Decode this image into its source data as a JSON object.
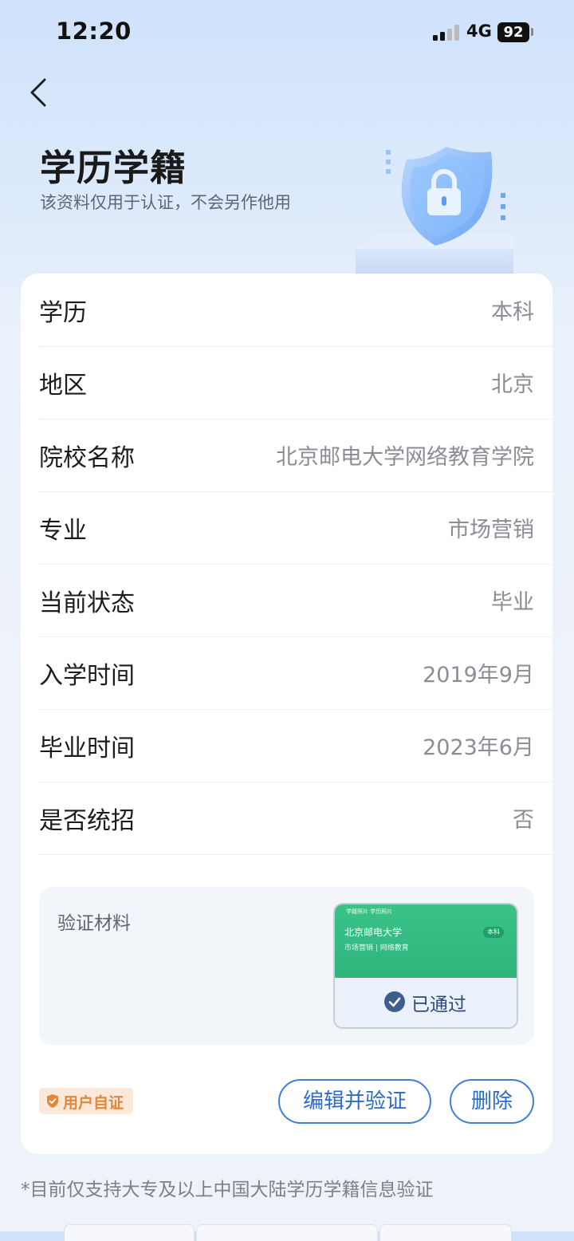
{
  "status_bar": {
    "time": "12:20",
    "network": "4G",
    "battery": "92"
  },
  "header": {
    "title": "学历学籍",
    "subtitle": "该资料仅用于认证，不会另作他用"
  },
  "details": [
    {
      "label": "学历",
      "value": "本科"
    },
    {
      "label": "地区",
      "value": "北京"
    },
    {
      "label": "院校名称",
      "value": "北京邮电大学网络教育学院"
    },
    {
      "label": "专业",
      "value": "市场营销"
    },
    {
      "label": "当前状态",
      "value": "毕业"
    },
    {
      "label": "入学时间",
      "value": "2019年9月"
    },
    {
      "label": "毕业时间",
      "value": "2023年6月"
    },
    {
      "label": "是否统招",
      "value": "否"
    }
  ],
  "material": {
    "label": "验证材料",
    "thumbnail": {
      "tabs": "学籍照片     学历照片",
      "school": "北京邮电大学",
      "major": "市场营销  |  网络教育",
      "badge": "本科"
    },
    "status": "已通过"
  },
  "actions": {
    "user_badge": "用户自证",
    "edit_label": "编辑并验证",
    "delete_label": "删除"
  },
  "footnote": "*目前仅支持大专及以上中国大陆学历学籍信息验证",
  "colors": {
    "accent": "#2a6bcb",
    "thumb_green": "#2fb57c",
    "badge_orange": "#e0873a",
    "value_gray": "#8a8d94"
  },
  "icons": {
    "back": "chevron-left-icon",
    "hero": "shield-lock-icon",
    "passed": "check-circle-icon",
    "user_badge": "shield-check-icon"
  }
}
